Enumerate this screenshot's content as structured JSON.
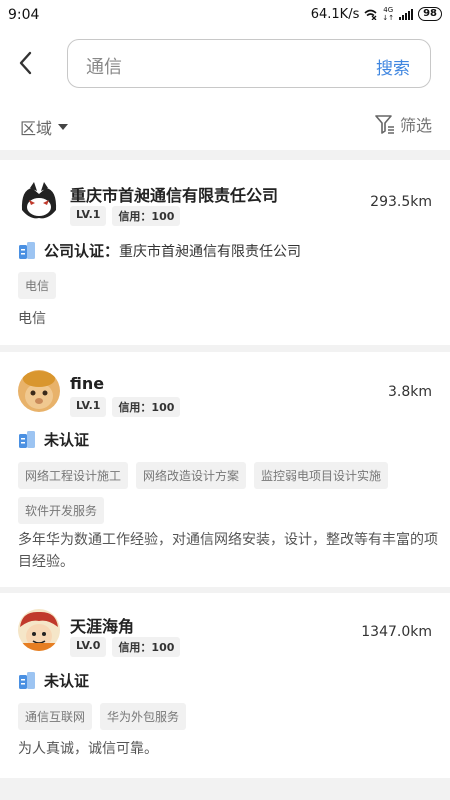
{
  "status_bar": {
    "time": "9:04",
    "speed": "64.1K/s",
    "network": "4G",
    "battery": "98"
  },
  "header": {
    "back_icon": "chevron-left-icon",
    "search_value": "通信",
    "search_label": "搜索"
  },
  "filter_bar": {
    "region_label": "区域",
    "filter_label": "筛选"
  },
  "results": [
    {
      "name": "重庆市首昶通信有限责任公司",
      "level": "LV.1",
      "credit": "信用：100",
      "distance": "293.5km",
      "cert_label": "公司认证：",
      "cert_value": "重庆市首昶通信有限责任公司",
      "tags": [
        "电信"
      ],
      "description": "电信"
    },
    {
      "name": "fine",
      "level": "LV.1",
      "credit": "信用：100",
      "distance": "3.8km",
      "cert_label": "未认证",
      "tags": [
        "网络工程设计施工",
        "网络改造设计方案",
        "监控弱电项目设计实施",
        "软件开发服务"
      ],
      "description": "多年华为数通工作经验，对通信网络安装，设计，整改等有丰富的项目经验。"
    },
    {
      "name": "天涯海角",
      "level": "LV.0",
      "credit": "信用：100",
      "distance": "1347.0km",
      "cert_label": "未认证",
      "tags": [
        "通信互联网",
        "华为外包服务"
      ],
      "description": "为人真诚，诚信可靠。"
    }
  ],
  "colors": {
    "accent": "#3f86e0",
    "cert_icon": "#4a90e2"
  }
}
